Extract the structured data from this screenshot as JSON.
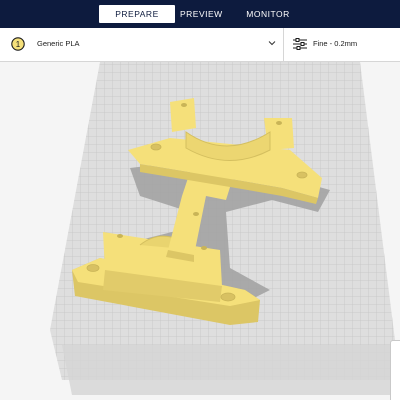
{
  "header": {
    "tabs": [
      {
        "label": "PREPARE",
        "active": true
      },
      {
        "label": "PREVIEW",
        "active": false
      },
      {
        "label": "MONITOR",
        "active": false
      }
    ]
  },
  "settings": {
    "extruder_number": "1",
    "material": "Generic PLA",
    "profile": "Fine - 0.2mm",
    "icons": {
      "material_dropdown": "chevron-down-icon",
      "profile": "sliders-icon"
    }
  },
  "colors": {
    "nav_background": "#0d1b3e",
    "model_yellow": "#f5e07a",
    "build_plate": "#dedede",
    "grid_lines": "#c3c3c3",
    "shadow": "#a0a0a0"
  }
}
